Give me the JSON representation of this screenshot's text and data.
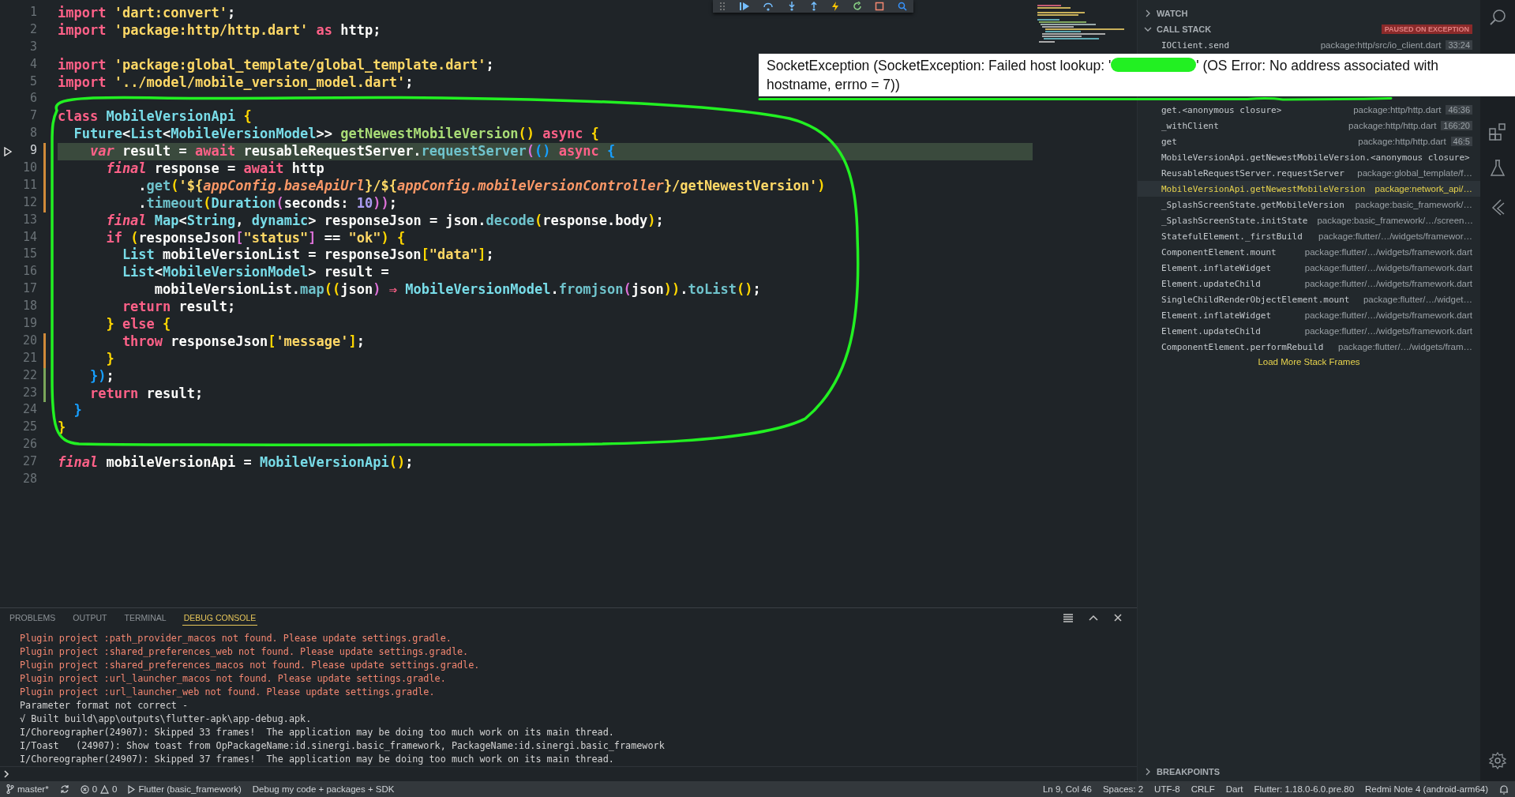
{
  "editor": {
    "lines": [
      {
        "number": "1",
        "current": false,
        "tokens": [
          {
            "text": "import ",
            "kind": "kw"
          },
          {
            "text": "'dart:convert'",
            "kind": "str"
          },
          {
            "text": ";",
            "kind": "plain"
          }
        ]
      },
      {
        "number": "2",
        "current": false,
        "tokens": [
          {
            "text": "import ",
            "kind": "kw"
          },
          {
            "text": "'package:http/http.dart'",
            "kind": "str"
          },
          {
            "text": " as ",
            "kind": "kw"
          },
          {
            "text": "http;",
            "kind": "plain"
          }
        ]
      },
      {
        "number": "3",
        "current": false
      },
      {
        "number": "4",
        "current": false,
        "tokens": [
          {
            "text": "import ",
            "kind": "kw"
          },
          {
            "text": "'package:global_template/global_template.dart'",
            "kind": "str"
          },
          {
            "text": ";",
            "kind": "plain"
          }
        ]
      },
      {
        "number": "5",
        "current": false,
        "tokens": [
          {
            "text": "import ",
            "kind": "kw"
          },
          {
            "text": "'../model/mobile_version_model.dart'",
            "kind": "str"
          },
          {
            "text": ";",
            "kind": "plain"
          }
        ]
      },
      {
        "number": "6",
        "current": false
      },
      {
        "number": "7",
        "current": false,
        "tokens": [
          {
            "text": "class ",
            "kind": "kw"
          },
          {
            "text": "MobileVersionApi ",
            "kind": "type"
          },
          {
            "text": "{",
            "kind": "br1"
          }
        ]
      },
      {
        "number": "8",
        "current": false,
        "tokens": [
          {
            "text": "  Future",
            "kind": "type"
          },
          {
            "text": "<",
            "kind": "plain"
          },
          {
            "text": "List",
            "kind": "type"
          },
          {
            "text": "<",
            "kind": "plain"
          },
          {
            "text": "MobileVersionModel",
            "kind": "type"
          },
          {
            "text": ">> ",
            "kind": "plain"
          },
          {
            "text": "getNewestMobileVersion",
            "kind": "fn"
          },
          {
            "text": "()",
            "kind": "br1"
          },
          {
            "text": " async ",
            "kind": "kw"
          },
          {
            "text": "{",
            "kind": "br1"
          }
        ]
      },
      {
        "number": "9",
        "current": true,
        "color": "#d08a3a",
        "tokens": [
          {
            "text": "    var",
            "kind": "kwi"
          },
          {
            "text": " result = ",
            "kind": "plain"
          },
          {
            "text": "await",
            "kind": "kw"
          },
          {
            "text": " reusableRequestServer.",
            "kind": "plain"
          },
          {
            "text": "requestServer",
            "kind": "method"
          },
          {
            "text": "(",
            "kind": "br2"
          },
          {
            "text": "()",
            "kind": "br3"
          },
          {
            "text": " async ",
            "kind": "kw"
          },
          {
            "text": "{",
            "kind": "br3"
          }
        ]
      },
      {
        "number": "10",
        "current": false,
        "color": "#d08a3a",
        "tokens": [
          {
            "text": "      final",
            "kind": "kwi"
          },
          {
            "text": " response = ",
            "kind": "plain"
          },
          {
            "text": "await",
            "kind": "kw"
          },
          {
            "text": " http",
            "kind": "plain"
          }
        ]
      },
      {
        "number": "11",
        "current": false,
        "color": "#d08a3a",
        "tokens": [
          {
            "text": "          .",
            "kind": "plain"
          },
          {
            "text": "get",
            "kind": "method"
          },
          {
            "text": "(",
            "kind": "br1"
          },
          {
            "text": "'${",
            "kind": "str"
          },
          {
            "text": "appConfig.baseApiUrl",
            "kind": "stri"
          },
          {
            "text": "}/${",
            "kind": "str"
          },
          {
            "text": "appConfig.mobileVersionController",
            "kind": "stri"
          },
          {
            "text": "}/getNewestVersion'",
            "kind": "str"
          },
          {
            "text": ")",
            "kind": "br1"
          }
        ]
      },
      {
        "number": "12",
        "current": false,
        "color": "#d08a3a",
        "tokens": [
          {
            "text": "          .",
            "kind": "plain"
          },
          {
            "text": "timeout",
            "kind": "method"
          },
          {
            "text": "(",
            "kind": "br1"
          },
          {
            "text": "Duration",
            "kind": "type"
          },
          {
            "text": "(",
            "kind": "br2"
          },
          {
            "text": "seconds: ",
            "kind": "plain"
          },
          {
            "text": "10",
            "kind": "num"
          },
          {
            "text": "))",
            "kind": "br2"
          },
          {
            "text": ";",
            "kind": "plain"
          }
        ]
      },
      {
        "number": "13",
        "current": false,
        "tokens": [
          {
            "text": "      final",
            "kind": "kwi"
          },
          {
            "text": " Map",
            "kind": "type"
          },
          {
            "text": "<",
            "kind": "plain"
          },
          {
            "text": "String",
            "kind": "type"
          },
          {
            "text": ", ",
            "kind": "plain"
          },
          {
            "text": "dynamic",
            "kind": "type"
          },
          {
            "text": "> responseJson = json.",
            "kind": "plain"
          },
          {
            "text": "decode",
            "kind": "method"
          },
          {
            "text": "(",
            "kind": "br1"
          },
          {
            "text": "response.body",
            "kind": "plain"
          },
          {
            "text": ")",
            "kind": "br1"
          },
          {
            "text": ";",
            "kind": "plain"
          }
        ]
      },
      {
        "number": "14",
        "current": false,
        "tokens": [
          {
            "text": "      if ",
            "kind": "kw"
          },
          {
            "text": "(",
            "kind": "br1"
          },
          {
            "text": "responseJson",
            "kind": "plain"
          },
          {
            "text": "[",
            "kind": "br2"
          },
          {
            "text": "\"status\"",
            "kind": "str"
          },
          {
            "text": "]",
            "kind": "br2"
          },
          {
            "text": " == ",
            "kind": "plain"
          },
          {
            "text": "\"ok\"",
            "kind": "str"
          },
          {
            "text": ")",
            "kind": "br1"
          },
          {
            "text": " {",
            "kind": "br1"
          }
        ]
      },
      {
        "number": "15",
        "current": false,
        "tokens": [
          {
            "text": "        List",
            "kind": "type"
          },
          {
            "text": " mobileVersionList = responseJson",
            "kind": "plain"
          },
          {
            "text": "[",
            "kind": "br1"
          },
          {
            "text": "\"data\"",
            "kind": "str"
          },
          {
            "text": "]",
            "kind": "br1"
          },
          {
            "text": ";",
            "kind": "plain"
          }
        ]
      },
      {
        "number": "16",
        "current": false,
        "tokens": [
          {
            "text": "        List",
            "kind": "type"
          },
          {
            "text": "<",
            "kind": "plain"
          },
          {
            "text": "MobileVersionModel",
            "kind": "type"
          },
          {
            "text": "> result =",
            "kind": "plain"
          }
        ]
      },
      {
        "number": "17",
        "current": false,
        "tokens": [
          {
            "text": "            mobileVersionList.",
            "kind": "plain"
          },
          {
            "text": "map",
            "kind": "method"
          },
          {
            "text": "((",
            "kind": "br1"
          },
          {
            "text": "json",
            "kind": "plain"
          },
          {
            "text": ")",
            "kind": "br2"
          },
          {
            "text": " ⇒ ",
            "kind": "kw"
          },
          {
            "text": "MobileVersionModel",
            "kind": "type"
          },
          {
            "text": ".",
            "kind": "plain"
          },
          {
            "text": "fromjson",
            "kind": "method"
          },
          {
            "text": "(",
            "kind": "br2"
          },
          {
            "text": "json",
            "kind": "plain"
          },
          {
            "text": "))",
            "kind": "br1"
          },
          {
            "text": ".",
            "kind": "plain"
          },
          {
            "text": "toList",
            "kind": "method"
          },
          {
            "text": "()",
            "kind": "br1"
          },
          {
            "text": ";",
            "kind": "plain"
          }
        ]
      },
      {
        "number": "18",
        "current": false,
        "tokens": [
          {
            "text": "        return",
            "kind": "kw"
          },
          {
            "text": " result;",
            "kind": "plain"
          }
        ]
      },
      {
        "number": "19",
        "current": false,
        "tokens": [
          {
            "text": "      }",
            "kind": "br1"
          },
          {
            "text": " else ",
            "kind": "kw"
          },
          {
            "text": "{",
            "kind": "br1"
          }
        ]
      },
      {
        "number": "20",
        "current": false,
        "color": "#d08a3a",
        "tokens": [
          {
            "text": "        throw",
            "kind": "kw"
          },
          {
            "text": " responseJson",
            "kind": "plain"
          },
          {
            "text": "[",
            "kind": "br1"
          },
          {
            "text": "'message'",
            "kind": "str"
          },
          {
            "text": "]",
            "kind": "br1"
          },
          {
            "text": ";",
            "kind": "plain"
          }
        ]
      },
      {
        "number": "21",
        "current": false,
        "color": "#d08a3a",
        "tokens": [
          {
            "text": "      }",
            "kind": "br1"
          }
        ]
      },
      {
        "number": "22",
        "current": false,
        "color": "#7aa65a",
        "tokens": [
          {
            "text": "    })",
            "kind": "br3"
          },
          {
            "text": ";",
            "kind": "plain"
          }
        ]
      },
      {
        "number": "23",
        "current": false,
        "color": "#7aa65a",
        "tokens": [
          {
            "text": "    return",
            "kind": "kw"
          },
          {
            "text": " result;",
            "kind": "plain"
          }
        ]
      },
      {
        "number": "24",
        "current": false,
        "tokens": [
          {
            "text": "  }",
            "kind": "br3"
          }
        ]
      },
      {
        "number": "25",
        "current": false,
        "tokens": [
          {
            "text": "}",
            "kind": "br1"
          }
        ]
      },
      {
        "number": "26",
        "current": false
      },
      {
        "number": "27",
        "current": false,
        "tokens": [
          {
            "text": "final",
            "kind": "kwi"
          },
          {
            "text": " mobileVersionApi = ",
            "kind": "plain"
          },
          {
            "text": "MobileVersionApi",
            "kind": "type"
          },
          {
            "text": "()",
            "kind": "br1"
          },
          {
            "text": ";",
            "kind": "plain"
          }
        ]
      },
      {
        "number": "28",
        "current": false
      }
    ]
  },
  "exception_popup": {
    "message_start": "SocketException (SocketException: Failed host lookup: '",
    "message_middle": "' (OS Error: No address associated with",
    "message_end": "hostname, errno = 7))"
  },
  "sidebar": {
    "watch": {
      "title": "WATCH",
      "expanded": false
    },
    "call_stack": {
      "title": "CALL STACK",
      "expanded": true,
      "badge": "PAUSED ON EXCEPTION",
      "frames_before_popup": [
        {
          "name": "IOClient.send",
          "source": "package:http/src/io_client.dart",
          "position": "33:24",
          "selected": false
        }
      ],
      "frames": [
        {
          "name": "get.<anonymous closure>",
          "source": "package:http/http.dart",
          "position": "46:36",
          "selected": false
        },
        {
          "name": "_withClient",
          "source": "package:http/http.dart",
          "position": "166:20",
          "selected": false
        },
        {
          "name": "get",
          "source": "package:http/http.dart",
          "position": "46:5",
          "selected": false
        },
        {
          "name": "MobileVersionApi.getNewestMobileVersion.<anonymous closure>",
          "selected": false
        },
        {
          "name": "ReusableRequestServer.requestServer",
          "source": "package:global_template/f…",
          "selected": false
        },
        {
          "name": "MobileVersionApi.getNewestMobileVersion",
          "source": "package:network_api/…",
          "selected": true
        },
        {
          "name": "_SplashScreenState.getMobileVersion",
          "source": "package:basic_framework/…",
          "selected": false
        },
        {
          "name": "_SplashScreenState.initState",
          "source": "package:basic_framework/…/screen…",
          "selected": false
        },
        {
          "name": "StatefulElement._firstBuild",
          "source": "package:flutter/…/widgets/framewor…",
          "selected": false
        },
        {
          "name": "ComponentElement.mount",
          "source": "package:flutter/…/widgets/framework.dart",
          "selected": false
        },
        {
          "name": "Element.inflateWidget",
          "source": "package:flutter/…/widgets/framework.dart",
          "selected": false
        },
        {
          "name": "Element.updateChild",
          "source": "package:flutter/…/widgets/framework.dart",
          "selected": false
        },
        {
          "name": "SingleChildRenderObjectElement.mount",
          "source": "package:flutter/…/widget…",
          "selected": false
        },
        {
          "name": "Element.inflateWidget",
          "source": "package:flutter/…/widgets/framework.dart",
          "selected": false
        },
        {
          "name": "Element.updateChild",
          "source": "package:flutter/…/widgets/framework.dart",
          "selected": false
        },
        {
          "name": "ComponentElement.performRebuild",
          "source": "package:flutter/…/widgets/fram…",
          "selected": false
        }
      ],
      "load_more": "Load More Stack Frames"
    },
    "breakpoints": {
      "title": "BREAKPOINTS",
      "expanded": false
    }
  },
  "panel": {
    "tabs": [
      {
        "label": "PROBLEMS",
        "selected": false
      },
      {
        "label": "OUTPUT",
        "selected": false
      },
      {
        "label": "TERMINAL",
        "selected": false
      },
      {
        "label": "DEBUG CONSOLE",
        "selected": true
      }
    ],
    "console": [
      {
        "text": "Plugin project :path_provider_macos not found. Please update settings.gradle.",
        "kind": "error"
      },
      {
        "text": "Plugin project :shared_preferences_web not found. Please update settings.gradle.",
        "kind": "error"
      },
      {
        "text": "Plugin project :shared_preferences_macos not found. Please update settings.gradle.",
        "kind": "error"
      },
      {
        "text": "Plugin project :url_launcher_macos not found. Please update settings.gradle.",
        "kind": "error"
      },
      {
        "text": "Plugin project :url_launcher_web not found. Please update settings.gradle.",
        "kind": "error"
      },
      {
        "text": "Parameter format not correct -",
        "kind": "info"
      },
      {
        "text": "√ Built build\\app\\outputs\\flutter-apk\\app-debug.apk.",
        "kind": "info"
      },
      {
        "text": "I/Choreographer(24907): Skipped 33 frames!  The application may be doing too much work on its main thread.",
        "kind": "info"
      },
      {
        "text": "I/Toast   (24907): Show toast from OpPackageName:id.sinergi.basic_framework, PackageName:id.sinergi.basic_framework",
        "kind": "info"
      },
      {
        "text": "I/Choreographer(24907): Skipped 37 frames!  The application may be doing too much work on its main thread.",
        "kind": "info"
      }
    ]
  },
  "status_bar": {
    "branch": "master*",
    "errors": "0",
    "warnings": "0",
    "launch": "Flutter (basic_framework)",
    "debug_mode": "Debug my code + packages + SDK",
    "right_items": [
      "Ln 9, Col 46",
      "Spaces: 2",
      "UTF-8",
      "CRLF",
      "Dart",
      "Flutter: 1.18.0-6.0.pre.80",
      "Redmi Note 4 (android-arm64)"
    ]
  }
}
